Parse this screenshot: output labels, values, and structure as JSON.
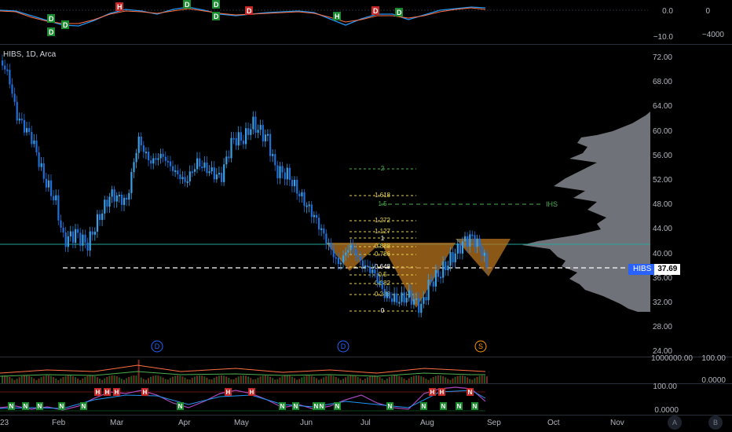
{
  "chart": {
    "title": "HIBS, 1D, Arca",
    "ticker": "HIBS",
    "last_price": "37.69",
    "pattern_label": "IHS",
    "year_fragment": "23"
  },
  "price_axis": [
    "72.00",
    "68.00",
    "64.00",
    "60.00",
    "56.00",
    "52.00",
    "48.00",
    "44.00",
    "40.00",
    "36.00",
    "32.00",
    "28.00",
    "24.00"
  ],
  "fib_levels": [
    "2",
    "1.618",
    "1.5",
    "1.272",
    "1.127",
    "1",
    "0.888",
    "0.786",
    "0.648",
    "0.5",
    "0.382",
    "0.236",
    "0"
  ],
  "time_axis": [
    "Feb",
    "Mar",
    "Apr",
    "May",
    "Jun",
    "Jul",
    "Aug",
    "Sep",
    "Oct",
    "Nov"
  ],
  "top_panel": {
    "axis_left": [
      "0.0",
      "−10.0"
    ],
    "axis_right": [
      "0",
      "−4000"
    ]
  },
  "volume_panel": {
    "axis_left": "1000000.00",
    "axis_right": "100.00"
  },
  "rsi_panel": {
    "axis_left": [
      "100.00",
      "0.0000"
    ],
    "axis_right": "0.0000"
  },
  "event_markers": [
    "D",
    "D",
    "S"
  ],
  "signals_top": [
    "D",
    "D",
    "D",
    "H",
    "D",
    "D",
    "D",
    "D",
    "H",
    "D",
    "D"
  ],
  "signals_bottom": [
    "N",
    "N",
    "N",
    "N",
    "N",
    "N",
    "N",
    "N",
    "N",
    "N",
    "N",
    "N",
    "N",
    "N",
    "N",
    "N"
  ],
  "signals_bottom_h": [
    "H",
    "H",
    "H",
    "H",
    "H",
    "H",
    "H",
    "H",
    "N",
    "N"
  ],
  "corner_buttons": [
    "A",
    "B"
  ],
  "colors": {
    "bull": "#3ea0e0",
    "bear": "#1e6fd8",
    "fib": "#e8d44d",
    "ihs": "#4caf50",
    "pattern_fill": "#b8741f",
    "profile": "#9598a1",
    "support": "#26a69a"
  }
}
